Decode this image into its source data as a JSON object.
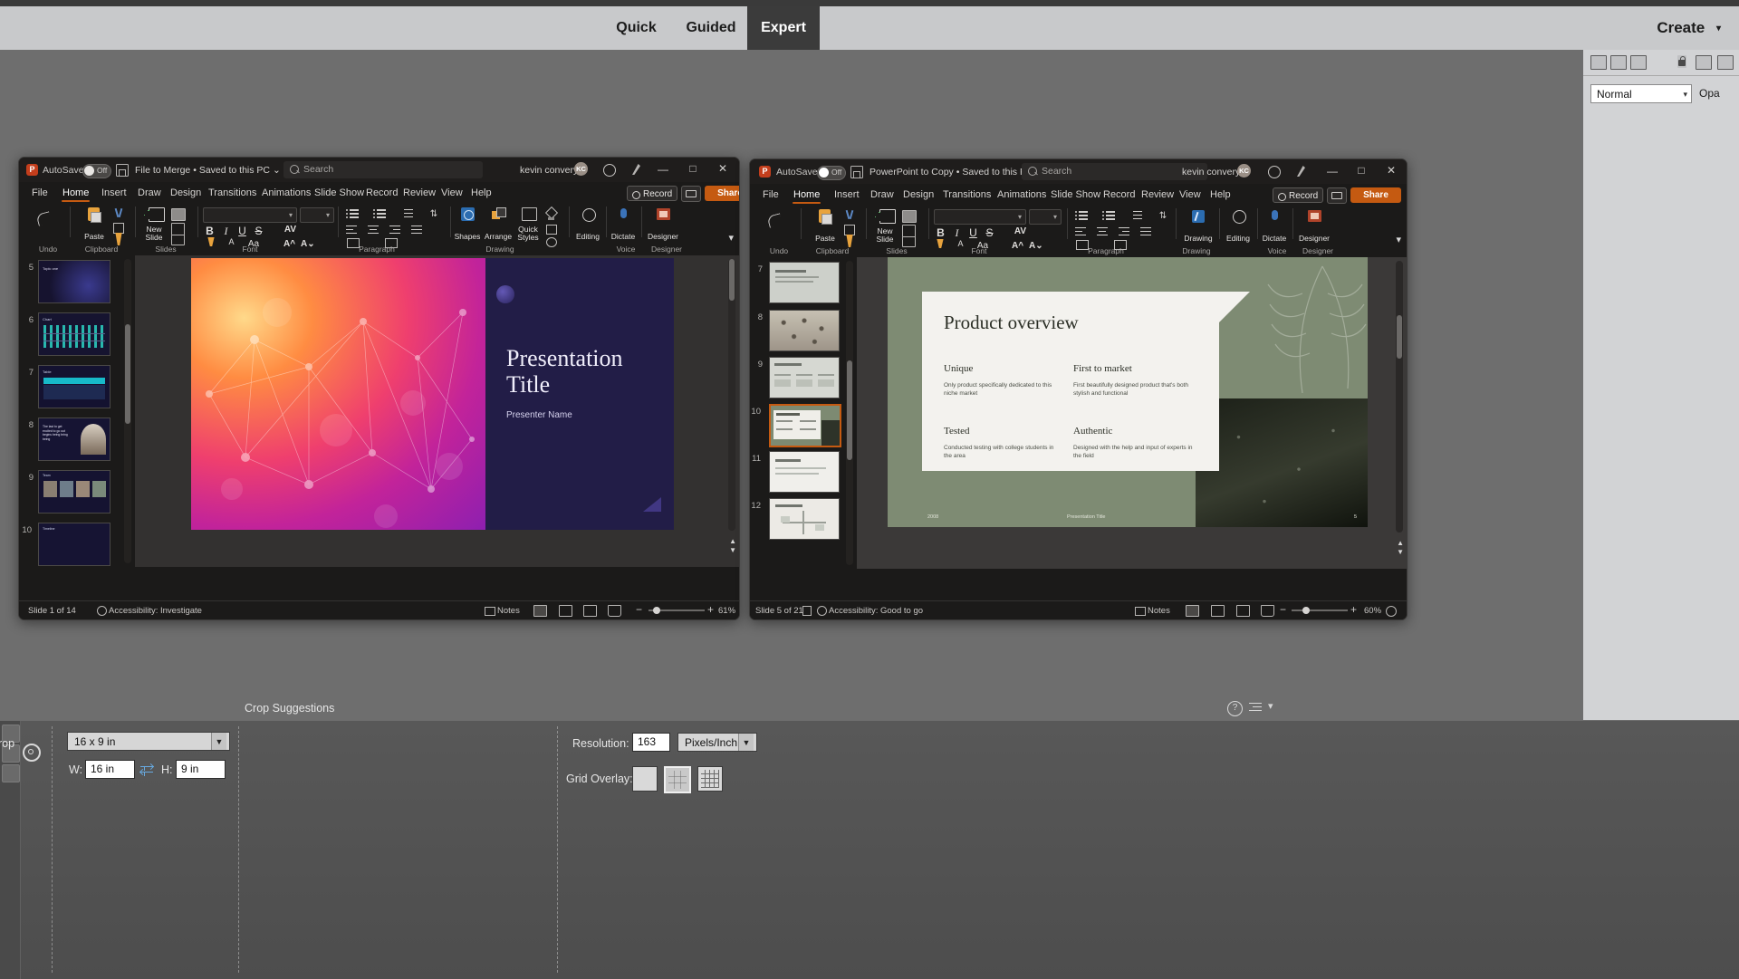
{
  "modebar": {
    "modes": [
      {
        "label": "Quick",
        "selected": false
      },
      {
        "label": "Guided",
        "selected": false
      },
      {
        "label": "Expert",
        "selected": true
      }
    ],
    "create_label": "Create",
    "create_caret": "▾"
  },
  "palette": {
    "blend_mode": "Normal",
    "opacity_label": "Opa",
    "caret": "▾"
  },
  "tool_options": {
    "tool_label": "rop",
    "crop_suggestions_label": "Crop Suggestions",
    "aspect_ratio": "16 x 9 in",
    "width_label": "W:",
    "width_value": "16 in",
    "height_label": "H:",
    "height_value": "9 in",
    "resolution_label": "Resolution:",
    "resolution_value": "163",
    "resolution_unit": "Pixels/Inch",
    "grid_overlay_label": "Grid Overlay:",
    "grid_options": [
      {
        "name": "none",
        "selected": false
      },
      {
        "name": "rule-of-thirds",
        "selected": true
      },
      {
        "name": "fine-grid",
        "selected": false
      }
    ]
  },
  "windows": [
    {
      "id": "left",
      "titlebar": {
        "app_initial": "P",
        "autosave_label": "AutoSave",
        "autosave_state": "Off",
        "document_name": "File to Merge",
        "save_location": "Saved to this PC",
        "separator": "•",
        "caret": "⌄",
        "search_placeholder": "Search",
        "user_name": "kevin convery",
        "user_initials": "KC",
        "minimize": "—",
        "maximize": "□",
        "close": "✕"
      },
      "ribbon": {
        "tabs": [
          {
            "label": "File",
            "active": false
          },
          {
            "label": "Home",
            "active": true
          },
          {
            "label": "Insert",
            "active": false
          },
          {
            "label": "Draw",
            "active": false
          },
          {
            "label": "Design",
            "active": false
          },
          {
            "label": "Transitions",
            "active": false
          },
          {
            "label": "Animations",
            "active": false
          },
          {
            "label": "Slide Show",
            "active": false
          },
          {
            "label": "Record",
            "active": false
          },
          {
            "label": "Review",
            "active": false
          },
          {
            "label": "View",
            "active": false
          },
          {
            "label": "Help",
            "active": false
          }
        ],
        "record_button": "Record",
        "share_button": "Share",
        "share_caret": "⌄",
        "groups": [
          {
            "label": "Undo"
          },
          {
            "label": "Clipboard"
          },
          {
            "label": "Slides"
          },
          {
            "label": "Font"
          },
          {
            "label": "Paragraph"
          },
          {
            "label": "Drawing"
          },
          {
            "label": "Voice"
          },
          {
            "label": "Designer"
          }
        ],
        "buttons": {
          "paste": "Paste",
          "new_slide": "New\nSlide",
          "shapes": "Shapes",
          "arrange": "Arrange",
          "quick_styles": "Quick\nStyles",
          "editing": "Editing",
          "dictate": "Dictate",
          "designer": "Designer"
        }
      },
      "slide_panel": {
        "thumbnails": [
          {
            "number": "5",
            "selected": false,
            "style": "network-dark",
            "caption": "Topic one"
          },
          {
            "number": "6",
            "selected": false,
            "style": "chart",
            "caption": "Chart"
          },
          {
            "number": "7",
            "selected": false,
            "style": "table",
            "caption": "Table"
          },
          {
            "number": "8",
            "selected": false,
            "style": "photo-text",
            "caption": "The last to get excited to go out begins being bring being"
          },
          {
            "number": "9",
            "selected": false,
            "style": "four-photo",
            "caption": "Team"
          },
          {
            "number": "10",
            "selected": false,
            "style": "timeline",
            "caption": "Timeline"
          }
        ]
      },
      "slide": {
        "title": "Presentation Title",
        "subtitle": "Presenter Name"
      },
      "status": {
        "slide_counter": "Slide 1 of 14",
        "accessibility": "Accessibility: Investigate",
        "notes": "Notes",
        "zoom": "61%",
        "zoom_out": "−",
        "zoom_in": "+"
      }
    },
    {
      "id": "right",
      "titlebar": {
        "app_initial": "P",
        "autosave_label": "AutoSave",
        "autosave_state": "Off",
        "document_name": "PowerPoint to Copy",
        "save_location": "Saved to this PC",
        "separator": "•",
        "caret": "⌄",
        "search_placeholder": "Search",
        "user_name": "kevin convery",
        "user_initials": "KC",
        "minimize": "—",
        "maximize": "□",
        "close": "✕"
      },
      "ribbon": {
        "tabs": [
          {
            "label": "File",
            "active": false
          },
          {
            "label": "Home",
            "active": true
          },
          {
            "label": "Insert",
            "active": false
          },
          {
            "label": "Draw",
            "active": false
          },
          {
            "label": "Design",
            "active": false
          },
          {
            "label": "Transitions",
            "active": false
          },
          {
            "label": "Animations",
            "active": false
          },
          {
            "label": "Slide Show",
            "active": false
          },
          {
            "label": "Record",
            "active": false
          },
          {
            "label": "Review",
            "active": false
          },
          {
            "label": "View",
            "active": false
          },
          {
            "label": "Help",
            "active": false
          }
        ],
        "record_button": "Record",
        "share_button": "Share",
        "share_caret": "⌄",
        "groups": [
          {
            "label": "Undo"
          },
          {
            "label": "Clipboard"
          },
          {
            "label": "Slides"
          },
          {
            "label": "Font"
          },
          {
            "label": "Paragraph"
          },
          {
            "label": "Drawing"
          },
          {
            "label": "Voice"
          },
          {
            "label": "Designer"
          }
        ],
        "buttons": {
          "paste": "Paste",
          "new_slide": "New\nSlide",
          "drawing": "Drawing",
          "editing": "Editing",
          "dictate": "Dictate",
          "designer": "Designer"
        }
      },
      "slide_panel": {
        "thumbnails": [
          {
            "number": "7",
            "selected": false,
            "style": "plain"
          },
          {
            "number": "8",
            "selected": false,
            "style": "leopard"
          },
          {
            "number": "9",
            "selected": false,
            "style": "three-col"
          },
          {
            "number": "10",
            "selected": true,
            "style": "product-overview"
          },
          {
            "number": "11",
            "selected": false,
            "style": "white"
          },
          {
            "number": "12",
            "selected": false,
            "style": "diagram"
          }
        ]
      },
      "slide": {
        "title": "Product overview",
        "columns": [
          {
            "heading": "Unique",
            "body": "Only product specifically dedicated to this niche market"
          },
          {
            "heading": "First to market",
            "body": "First beautifully designed product that's both stylish and functional"
          },
          {
            "heading": "Tested",
            "body": "Conducted testing with college students in the area"
          },
          {
            "heading": "Authentic",
            "body": "Designed with the help and input of experts in the field"
          }
        ],
        "footer_left": "2008",
        "footer_center": "Presentation Title",
        "footer_right": "5"
      },
      "status": {
        "slide_counter": "Slide 5 of 21",
        "accessibility": "Accessibility: Good to go",
        "notes": "Notes",
        "zoom": "60%",
        "zoom_out": "−",
        "zoom_in": "+"
      }
    }
  ]
}
